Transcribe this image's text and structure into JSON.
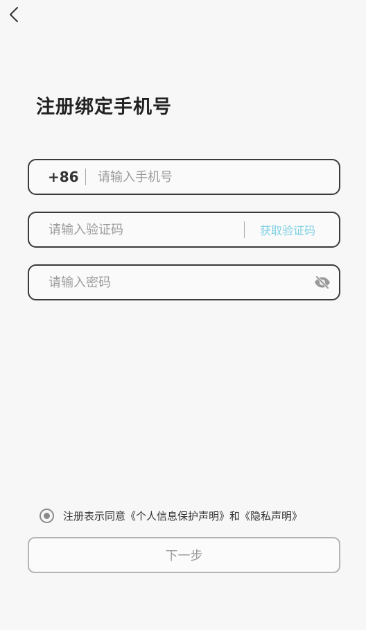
{
  "header": {
    "back_icon": "chevron-left-icon",
    "title": "注册绑定手机号"
  },
  "form": {
    "phone": {
      "prefix": "+86",
      "value": "",
      "placeholder": "请输入手机号"
    },
    "code": {
      "value": "",
      "placeholder": "请输入验证码",
      "get_code_label": "获取验证码"
    },
    "password": {
      "value": "",
      "placeholder": "请输入密码",
      "toggle_icon": "eye-off-icon"
    }
  },
  "agreement": {
    "prefix_text": "注册表示同意",
    "privacy_statement": "《个人信息保护声明》",
    "and_text": "和",
    "privacy_policy": "《隐私声明》"
  },
  "next_button_label": "下一步",
  "colors": {
    "accent_link": "#7fd0e2",
    "field_border": "#3a3a3a",
    "disabled_button_text": "#9a9a9a"
  }
}
